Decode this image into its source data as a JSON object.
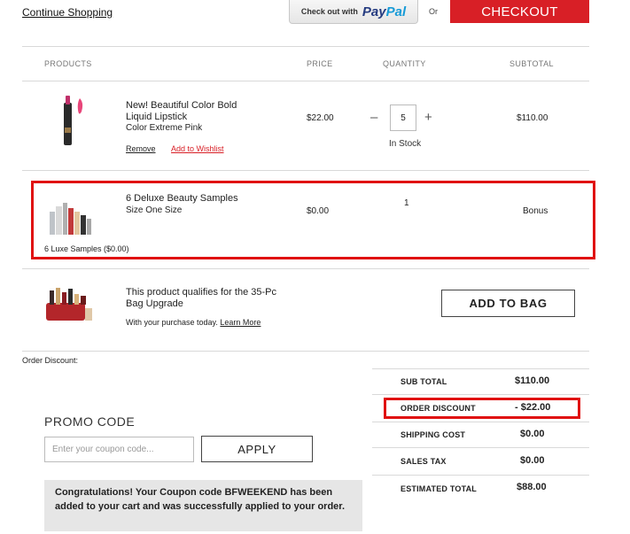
{
  "topbar": {
    "continue_shopping": "Continue Shopping",
    "paypal_prefix": "Check out with",
    "paypal_pay": "Pay",
    "paypal_pal": "Pal",
    "or": "Or",
    "checkout": "CHECKOUT"
  },
  "columns": {
    "products": "PRODUCTS",
    "price": "PRICE",
    "quantity": "QUANTITY",
    "subtotal": "SUBTOTAL"
  },
  "items": [
    {
      "title_line1": "New! Beautiful Color Bold",
      "title_line2": "Liquid Lipstick",
      "variant": "Color Extreme Pink",
      "remove": "Remove",
      "wishlist": "Add to Wishlist",
      "price": "$22.00",
      "quantity": "5",
      "stock": "In Stock",
      "subtotal": "$110.00",
      "image": "lipstick-product-image"
    },
    {
      "title": "6 Deluxe Beauty Samples",
      "variant": "Size One Size",
      "price": "$0.00",
      "quantity": "1",
      "subtotal": "Bonus",
      "caption": "6 Luxe Samples ($0.00)",
      "image": "samples-product-image"
    }
  ],
  "upgrade": {
    "title_line1": "This product qualifies for the 35-Pc",
    "title_line2": "Bag Upgrade",
    "sub": "With your purchase today.",
    "learn_more": "Learn More",
    "add_to_bag": "ADD TO BAG",
    "image": "bag-upgrade-image"
  },
  "order_discount_label": "Order Discount:",
  "promo": {
    "title": "PROMO CODE",
    "placeholder": "Enter your coupon code...",
    "apply": "APPLY",
    "message": "Congratulations! Your Coupon code BFWEEKEND has been added to your cart and was successfully applied to your order."
  },
  "summary": {
    "sub_total_label": "SUB TOTAL",
    "sub_total": "$110.00",
    "order_discount_label": "ORDER DISCOUNT",
    "order_discount": "- $22.00",
    "shipping_label": "SHIPPING COST",
    "shipping": "$0.00",
    "tax_label": "SALES TAX",
    "tax": "$0.00",
    "total_label": "ESTIMATED TOTAL",
    "total": "$88.00"
  },
  "colors": {
    "accent_red": "#d81f26",
    "highlight_box": "#e01010",
    "paypal_dark": "#253b80",
    "paypal_light": "#179bd7"
  }
}
